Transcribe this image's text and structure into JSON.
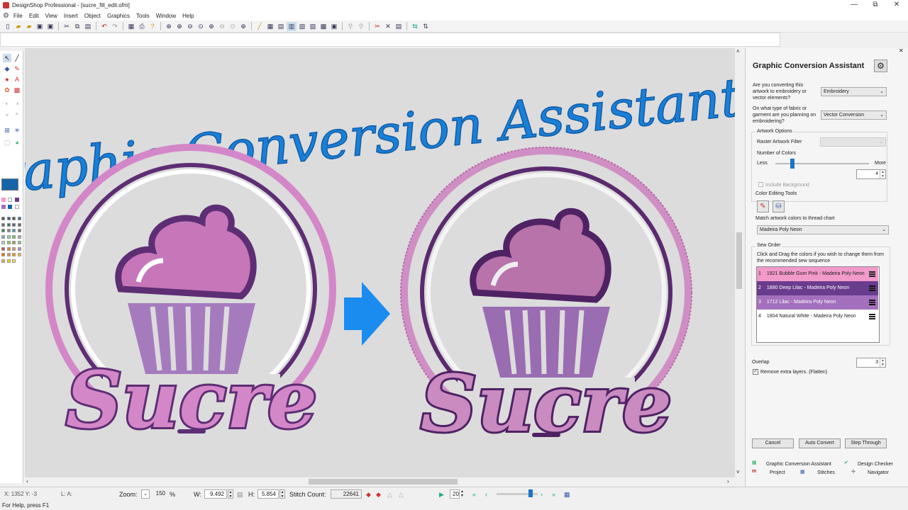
{
  "window": {
    "title": "DesignShop Professional - [sucre_fill_edit.ofm]",
    "minimize": "—",
    "restore": "⧉",
    "close": "✕"
  },
  "menu": [
    "File",
    "Edit",
    "View",
    "Insert",
    "Object",
    "Graphics",
    "Tools",
    "Window",
    "Help"
  ],
  "canvas": {
    "headline": "Graphic Conversion Assistant",
    "brand": "Sucre",
    "colors": {
      "headline": "#1a7fd6",
      "arrow": "#1a8cf0",
      "pink": "#d487c8",
      "purple": "#5e2e74",
      "lilac": "#a57bbe",
      "frosting": "#c676b9",
      "background": "#dcdcdc"
    }
  },
  "status": {
    "coords": "X: 1352  Y: -3",
    "la": "L: A:",
    "zoom_label": "Zoom:",
    "zoom_value": "150",
    "zoom_unit": "%",
    "w_label": "W:",
    "w_value": "9.492",
    "h_label": "H:",
    "h_value": "5.854",
    "stitch_label": "Stitch Count:",
    "stitch_value": "22641",
    "speed_value": "20",
    "help": "For Help, press F1"
  },
  "panel": {
    "title": "Graphic Conversion Assistant",
    "q1": "Are you converting this artwork to embroidery or vector elements?",
    "q1_value": "Embroidery",
    "q2": "On what type of fabric or garment are you planning on embroidering?",
    "q2_value": "Vector Conversion",
    "artwork_options": "Artwork Options",
    "raster_filter": "Raster Artwork Filter",
    "num_colors": "Number of Colors",
    "less": "Less",
    "more": "More",
    "num_colors_fraction": 0.18,
    "num_colors_value": "4",
    "include_background": "Include Background",
    "color_editing_tools": "Color Editing Tools",
    "match_label": "Match artwork colors to thread chart",
    "thread_chart": "Madeira Poly Neon",
    "sew_order": "Sew Order",
    "sew_help": "Click and Drag the colors if you wish to change them from the recommended sew sequence",
    "sew_items": [
      {
        "n": "1",
        "label": "1921 Bubble Gum Pink - Madeira Poly Neon",
        "bg": "#f29ac9",
        "fg": "#222"
      },
      {
        "n": "2",
        "label": "1880 Deep Lilac - Madeira Poly Neon",
        "bg": "#6a3c8e",
        "fg": "#fff"
      },
      {
        "n": "3",
        "label": "1712 Lilac - Madeira Poly Neon",
        "bg": "#a470bd",
        "fg": "#fff"
      },
      {
        "n": "4",
        "label": "1804 Natural White - Madeira Poly Neon",
        "bg": "#ffffff",
        "fg": "#222"
      }
    ],
    "overlap": "Overlap",
    "overlap_value": "3",
    "remove_layers": "Remove extra layers. (Flatten)",
    "cancel": "Cancel",
    "auto_convert": "Auto Convert",
    "step_through": "Step Through",
    "tabs": [
      "Graphic Conversion Assistant",
      "Design Checker",
      "Project",
      "Stitches",
      "Navigator"
    ]
  }
}
